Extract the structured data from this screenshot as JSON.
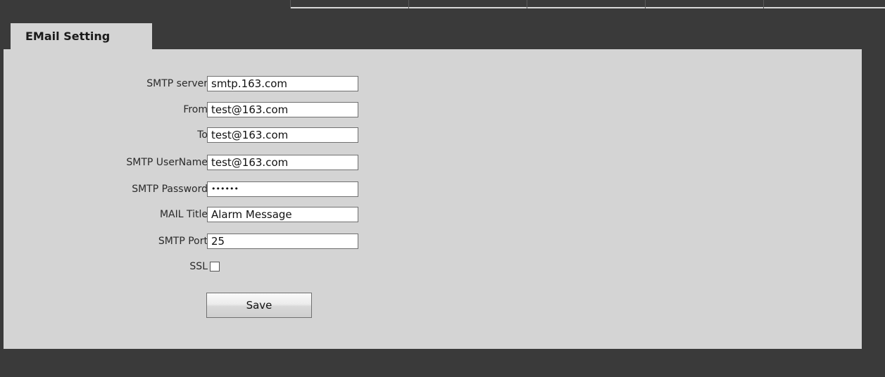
{
  "tab": {
    "label": "EMail Setting"
  },
  "form": {
    "smtp_server": {
      "label": "SMTP server",
      "value": "smtp.163.com"
    },
    "from": {
      "label": "From",
      "value": "test@163.com"
    },
    "to": {
      "label": "To",
      "value": "test@163.com"
    },
    "smtp_username": {
      "label": "SMTP UserName",
      "value": "test@163.com"
    },
    "smtp_password": {
      "label": "SMTP Password",
      "value": "••••••"
    },
    "mail_title": {
      "label": "MAIL Title",
      "value": "Alarm Message"
    },
    "smtp_port": {
      "label": "SMTP Port",
      "value": "25"
    },
    "ssl": {
      "label": "SSL",
      "checked": false
    }
  },
  "buttons": {
    "save_label": "Save"
  },
  "colors": {
    "background": "#3a3a3a",
    "panel": "#d4d4d4",
    "input_bg": "#ffffff"
  }
}
